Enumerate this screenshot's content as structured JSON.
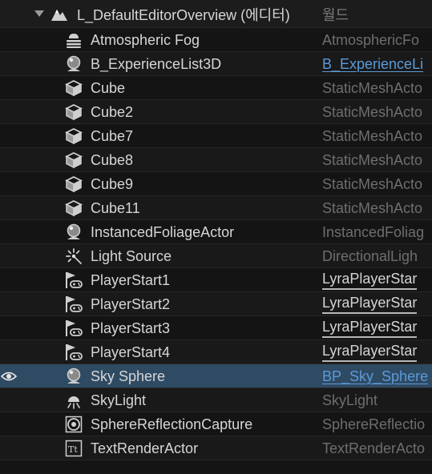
{
  "level": {
    "name": "L_DefaultEditorOverview (에디터)",
    "type": "월드"
  },
  "rows": [
    {
      "label": "Atmospheric Fog",
      "type": "AtmosphericFo",
      "icon": "fog-icon",
      "style": "muted"
    },
    {
      "label": "B_ExperienceList3D",
      "type": "B_ExperienceLi",
      "icon": "actor-sphere-icon",
      "style": "blueprint"
    },
    {
      "label": "Cube",
      "type": "StaticMeshActo",
      "icon": "static-mesh-icon",
      "style": "muted"
    },
    {
      "label": "Cube2",
      "type": "StaticMeshActo",
      "icon": "static-mesh-icon",
      "style": "muted"
    },
    {
      "label": "Cube7",
      "type": "StaticMeshActo",
      "icon": "static-mesh-icon",
      "style": "muted"
    },
    {
      "label": "Cube8",
      "type": "StaticMeshActo",
      "icon": "static-mesh-icon",
      "style": "muted"
    },
    {
      "label": "Cube9",
      "type": "StaticMeshActo",
      "icon": "static-mesh-icon",
      "style": "muted"
    },
    {
      "label": "Cube11",
      "type": "StaticMeshActo",
      "icon": "static-mesh-icon",
      "style": "muted"
    },
    {
      "label": "InstancedFoliageActor",
      "type": "InstancedFoliag",
      "icon": "actor-sphere-icon",
      "style": "muted"
    },
    {
      "label": "Light Source",
      "type": "DirectionalLigh",
      "icon": "directional-light-icon",
      "style": "muted"
    },
    {
      "label": "PlayerStart1",
      "type": "LyraPlayerStar",
      "icon": "player-start-icon",
      "style": "editable"
    },
    {
      "label": "PlayerStart2",
      "type": "LyraPlayerStar",
      "icon": "player-start-icon",
      "style": "editable"
    },
    {
      "label": "PlayerStart3",
      "type": "LyraPlayerStar",
      "icon": "player-start-icon",
      "style": "editable"
    },
    {
      "label": "PlayerStart4",
      "type": "LyraPlayerStar",
      "icon": "player-start-icon",
      "style": "editable"
    },
    {
      "label": "Sky Sphere",
      "type": "BP_Sky_Sphere",
      "icon": "actor-sphere-icon",
      "style": "blueprint",
      "selected": true
    },
    {
      "label": "SkyLight",
      "type": "SkyLight",
      "icon": "sky-light-icon",
      "style": "muted"
    },
    {
      "label": "SphereReflectionCapture",
      "type": "SphereReflectio",
      "icon": "reflection-capture-icon",
      "style": "muted"
    },
    {
      "label": "TextRenderActor",
      "type": "TextRenderActo",
      "icon": "text-render-icon",
      "style": "muted"
    }
  ],
  "colors": {
    "background": "#141414",
    "row_alt": "#191919",
    "selected_row": "#2f4a63",
    "blueprint_link": "#5a9bd9",
    "muted_type": "#6e6e6e"
  },
  "visibility_icon": "eye-icon"
}
